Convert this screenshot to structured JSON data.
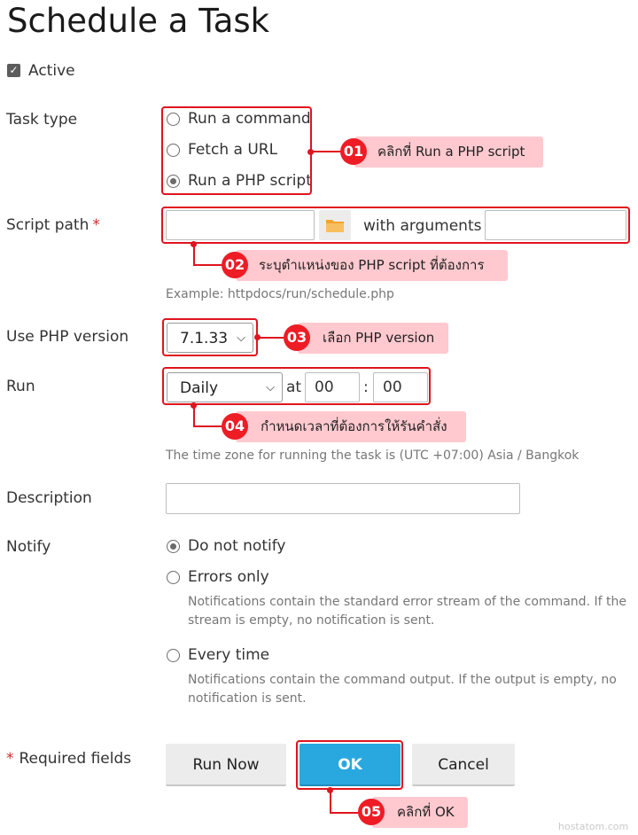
{
  "page": {
    "title": "Schedule a Task"
  },
  "active": {
    "label": "Active",
    "checked": true
  },
  "task_type": {
    "label": "Task type",
    "options": [
      {
        "label": "Run a command",
        "checked": false
      },
      {
        "label": "Fetch a URL",
        "checked": false
      },
      {
        "label": "Run a PHP script",
        "checked": true
      }
    ]
  },
  "script_path": {
    "label": "Script path",
    "required_mark": "*",
    "value": "",
    "arguments_label": "with arguments",
    "arguments_value": "",
    "example": "Example: httpdocs/run/schedule.php"
  },
  "php_version": {
    "label": "Use PHP version",
    "selected": "7.1.33"
  },
  "run": {
    "label": "Run",
    "frequency": "Daily",
    "at_label": "at",
    "hour": "00",
    "separator": ":",
    "minute": "00",
    "timezone_note": "The time zone for running the task is (UTC +07:00) Asia / Bangkok"
  },
  "description": {
    "label": "Description",
    "value": ""
  },
  "notify": {
    "label": "Notify",
    "options": [
      {
        "label": "Do not notify",
        "checked": true,
        "note": ""
      },
      {
        "label": "Errors only",
        "checked": false,
        "note": "Notifications contain the standard error stream of the command. If the stream is empty, no notification is sent."
      },
      {
        "label": "Every time",
        "checked": false,
        "note": "Notifications contain the command output. If the output is empty, no notification is sent."
      }
    ]
  },
  "footer": {
    "required_star": "*",
    "required_label": "Required fields",
    "run_now": "Run Now",
    "ok": "OK",
    "cancel": "Cancel"
  },
  "callouts": [
    {
      "number": "01",
      "text": "คลิกที่ Run a PHP script"
    },
    {
      "number": "02",
      "text": "ระบุตำแหน่งของ PHP script ที่ต้องการ"
    },
    {
      "number": "03",
      "text": "เลือก PHP version"
    },
    {
      "number": "04",
      "text": "กำหนดเวลาที่ต้องการให้รันคำสั่ง"
    },
    {
      "number": "05",
      "text": "คลิกที่ OK"
    }
  ],
  "watermark": "hostatom.com",
  "colors": {
    "accent": "#29a8e0",
    "annotation_red": "#e0141e",
    "annotation_bg": "#ffc9cf"
  }
}
